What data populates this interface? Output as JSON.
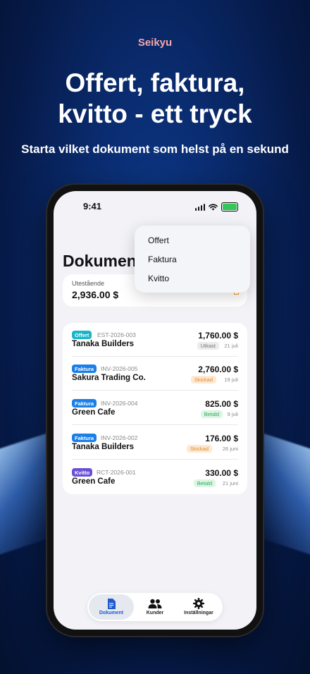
{
  "brand": "Seikyu",
  "headline": [
    "Offert, faktura,",
    "kvitto - ett tryck"
  ],
  "subline": "Starta vilket dokument som helst på en sekund",
  "status_bar": {
    "time": "9:41"
  },
  "page_title": "Dokument",
  "outstanding": {
    "label": "Utestående",
    "value": "2,936.00 $"
  },
  "new_menu": {
    "items": [
      "Offert",
      "Faktura",
      "Kvitto"
    ]
  },
  "documents": [
    {
      "type": "Offert",
      "type_color": "#17b5c8",
      "number": "EST-2026-003",
      "client": "Tanaka Builders",
      "amount": "1,760.00 $",
      "status": "Utkast",
      "status_bg": "#ececee",
      "status_fg": "#777777",
      "date": "21 juli"
    },
    {
      "type": "Faktura",
      "type_color": "#1a7fe8",
      "number": "INV-2026-005",
      "client": "Sakura Trading Co.",
      "amount": "2,760.00 $",
      "status": "Skickad",
      "status_bg": "#fde9d4",
      "status_fg": "#e08a2e",
      "date": "19 juli"
    },
    {
      "type": "Faktura",
      "type_color": "#1a7fe8",
      "number": "INV-2026-004",
      "client": "Green Cafe",
      "amount": "825.00 $",
      "status": "Betald",
      "status_bg": "#ddf5e4",
      "status_fg": "#2fa85a",
      "date": "9 juli"
    },
    {
      "type": "Faktura",
      "type_color": "#1a7fe8",
      "number": "INV-2026-002",
      "client": "Tanaka Builders",
      "amount": "176.00 $",
      "status": "Skickad",
      "status_bg": "#fde9d4",
      "status_fg": "#e08a2e",
      "date": "26 juni"
    },
    {
      "type": "Kvitto",
      "type_color": "#6a4fd8",
      "number": "RCT-2026-001",
      "client": "Green Cafe",
      "amount": "330.00 $",
      "status": "Betald",
      "status_bg": "#ddf5e4",
      "status_fg": "#2fa85a",
      "date": "21 juni"
    }
  ],
  "tabs": [
    {
      "label": "Dokument",
      "icon": "document-icon",
      "active": true
    },
    {
      "label": "Kunder",
      "icon": "people-icon",
      "active": false
    },
    {
      "label": "Inställningar",
      "icon": "gear-icon",
      "active": false
    }
  ],
  "colors": {
    "accent": "#1e5bd0",
    "background": "#0a2b6e"
  }
}
